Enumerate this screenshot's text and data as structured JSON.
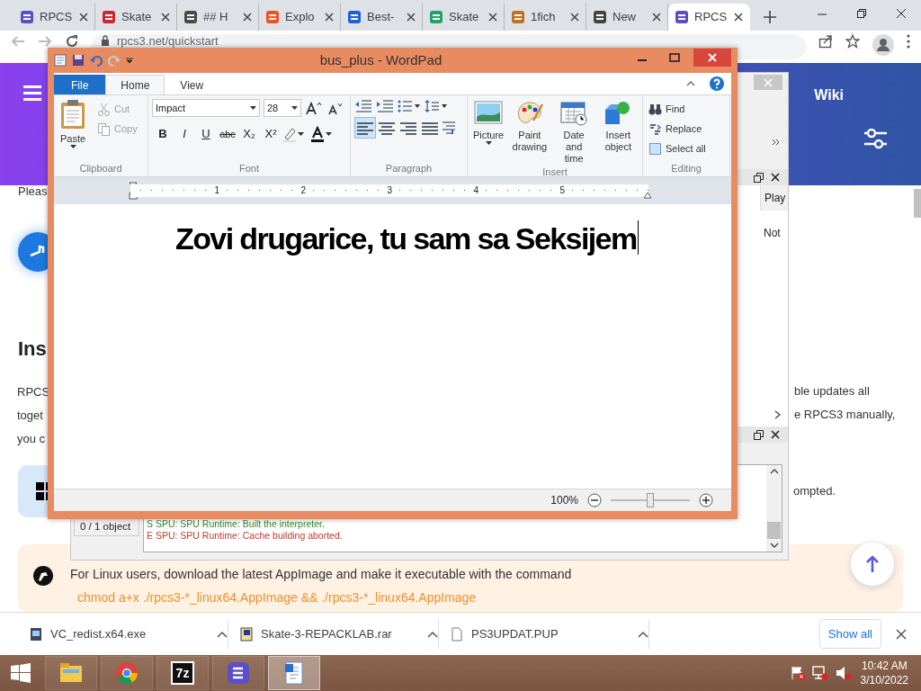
{
  "browser": {
    "tabs": [
      {
        "label": "RPCS",
        "color": "#5b4fc9",
        "selected": false
      },
      {
        "label": "Skate",
        "color": "#d0262f",
        "selected": false
      },
      {
        "label": "## H",
        "color": "#4a4a4a",
        "selected": false
      },
      {
        "label": "Explo",
        "color": "#f25022",
        "selected": false
      },
      {
        "label": "Best-",
        "color": "#1f5fd6",
        "selected": false
      },
      {
        "label": "Skate",
        "color": "#1fa463",
        "selected": false
      },
      {
        "label": "1fich",
        "color": "#c07020",
        "selected": false
      },
      {
        "label": "New",
        "color": "#444444",
        "selected": false
      },
      {
        "label": "RPCS",
        "color": "#5b4fc9",
        "selected": true
      }
    ],
    "address": "rpcs3.net/quickstart"
  },
  "website": {
    "nav_link": "Wiki",
    "intro_fragment": "Pleas",
    "heading_fragment": "Ins",
    "paragraph_lines": [
      {
        "left": "RPCS",
        "right": "ble updates all"
      },
      {
        "left": "toget",
        "right": "e RPCS3 manually,"
      },
      {
        "left": "you c"
      }
    ],
    "windows_note_fragment": "ompted.",
    "linux_note": {
      "text": "For Linux users, download the latest AppImage and make it executable with the command",
      "command": "chmod a+x ./rpcs3-*_linux64.AppImage && ./rpcs3-*_linux64.AppImage"
    }
  },
  "rpcs3": {
    "table": {
      "columns": [
        "Play"
      ],
      "rows": [
        [
          "Not"
        ]
      ]
    },
    "log": [
      {
        "text": "S SPU: SPU Runtime: Built the interpreter.",
        "kind": "success"
      },
      {
        "text": "E SPU: SPU Runtime: Cache building aborted.",
        "kind": "error"
      }
    ],
    "status": "0 / 1 object"
  },
  "wordpad": {
    "title": "bus_plus - WordPad",
    "tabs": [
      {
        "label": "File",
        "kind": "file",
        "selected": false
      },
      {
        "label": "Home",
        "kind": "tab",
        "selected": true
      },
      {
        "label": "View",
        "kind": "tab",
        "selected": false
      }
    ],
    "groups": [
      {
        "label": "Clipboard",
        "kind": "clipboard",
        "paste": "Paste",
        "items": [
          {
            "label": "Cut",
            "disabled": true
          },
          {
            "label": "Copy",
            "disabled": true
          }
        ]
      },
      {
        "label": "Font",
        "kind": "font",
        "font_name": "Impact",
        "font_size": "28",
        "styles": [
          "B",
          "I",
          "U",
          "abc",
          "X₂",
          "X²"
        ]
      },
      {
        "label": "Paragraph",
        "kind": "paragraph",
        "alignments": [
          {
            "selected": true
          },
          {
            "selected": false
          },
          {
            "selected": false
          },
          {
            "selected": false
          }
        ]
      },
      {
        "label": "Insert",
        "kind": "insert",
        "items": [
          "Picture",
          "Paint drawing",
          "Date and time",
          "Insert object"
        ]
      },
      {
        "label": "Editing",
        "kind": "editing",
        "items": [
          "Find",
          "Replace",
          "Select all"
        ]
      }
    ],
    "ruler": [
      "1",
      "2",
      "3",
      "4",
      "5"
    ],
    "document_text": "Zovi drugarice, tu sam sa Seksijem",
    "zoom": {
      "reading": "100%",
      "level": 0.5
    }
  },
  "downloads": {
    "items": [
      "VC_redist.x64.exe",
      "Skate-3-REPACKLAB.rar",
      "PS3UPDAT.PUP"
    ],
    "show_all": "Show all"
  },
  "taskbar": {
    "apps": [
      {
        "kind": "explorer",
        "active": false
      },
      {
        "kind": "chrome",
        "active": false
      },
      {
        "kind": "sevenzip",
        "glyph": "7z",
        "active": false
      },
      {
        "kind": "rpcs3",
        "active": false
      },
      {
        "kind": "wordpad",
        "active": true
      }
    ],
    "time": "10:42 AM",
    "date": "3/10/2022"
  }
}
